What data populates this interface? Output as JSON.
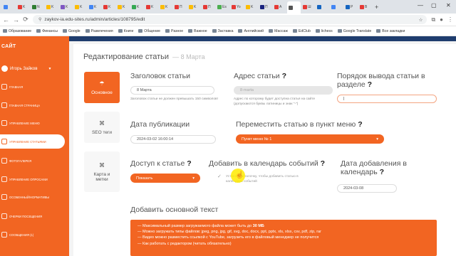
{
  "browser": {
    "url": "zaykov-ia.edu-sites.ru/admin/articles/108795/edit",
    "tabs": [
      {
        "label": "",
        "color": "#4285f4"
      },
      {
        "label": "K",
        "color": "#e53935"
      },
      {
        "label": "N",
        "color": "#2e7d32"
      },
      {
        "label": "K",
        "color": "#fbbc04"
      },
      {
        "label": "K",
        "color": "#7e57c2"
      },
      {
        "label": "K",
        "color": "#fbbc04"
      },
      {
        "label": "K",
        "color": "#4285f4"
      },
      {
        "label": "K",
        "color": "#e53935"
      },
      {
        "label": "K",
        "color": "#fbbc04"
      },
      {
        "label": "K",
        "color": "#34a853"
      },
      {
        "label": "K",
        "color": "#e53935"
      },
      {
        "label": "K",
        "color": "#fbbc04"
      },
      {
        "label": "П",
        "color": "#e53935"
      },
      {
        "label": "K",
        "color": "#fbbc04"
      },
      {
        "label": "П",
        "color": "#e53935"
      },
      {
        "label": "Es",
        "color": "#4caf50"
      },
      {
        "label": "Yo",
        "color": "#e53935"
      },
      {
        "label": "K",
        "color": "#fbbc04"
      },
      {
        "label": "П",
        "color": "#1a237e"
      },
      {
        "label": "А",
        "color": "#e53935"
      },
      {
        "label": "",
        "color": "#555555",
        "active": true
      },
      {
        "label": "Ш",
        "color": "#e53935"
      },
      {
        "label": "",
        "color": "#1565c0"
      },
      {
        "label": "",
        "color": "#4285f4"
      },
      {
        "label": "Р",
        "color": "#1565c0"
      },
      {
        "label": "В",
        "color": "#e53935"
      }
    ],
    "bookmarks": [
      "Образование",
      "Финансы",
      "Google",
      "Развлечения",
      "Книги",
      "Общение",
      "Разное",
      "Важное",
      "Заставка",
      "Английский",
      "Массаж",
      "EdClub",
      "lichess",
      "Google Translate",
      "Все закладки"
    ]
  },
  "sidebar": {
    "title": "САЙТ",
    "user": "Игорь Зайков",
    "items": [
      {
        "label": "Главная"
      },
      {
        "label": "Главная страница"
      },
      {
        "label": "Управление меню"
      },
      {
        "label": "Управление статьями",
        "active": true
      },
      {
        "label": "Фотогалерея"
      },
      {
        "label": "Управление опросами"
      },
      {
        "label": "Особенный/Нормативы"
      },
      {
        "label": "Очерки посещения"
      },
      {
        "label": "Сообщения (1)"
      }
    ]
  },
  "page": {
    "title": "Редактирование статьи",
    "date_suffix": "— 8 Марта"
  },
  "side_tabs": {
    "main": "Основное",
    "seo": "SEO теги",
    "map": "Карта и метки"
  },
  "fields": {
    "title_label": "Заголовок статьи",
    "title_value": "8 Марта",
    "title_hint": "Заголовок статьи не должен превышать 150 символов!",
    "address_label": "Адрес статьи",
    "address_value": "8-marta",
    "address_hint": "Адрес по которому будет доступна статья на сайте (допускаются буквы латиницы и знак \"-\")",
    "order_label": "Порядок вывода статьи в разделе",
    "order_value": "",
    "pubdate_label": "Дата публикации",
    "pubdate_value": "2024-03-02 16:00:14",
    "move_label": "Переместить статью в пункт меню",
    "move_value": "Пункт меню № 1",
    "access_label": "Доступ к статье",
    "access_value": "Показать",
    "calendar_label": "Добавить в календарь событий",
    "calendar_hint": "Установите галочку, чтобы добавить статью в календарь событий",
    "added_label": "Дата добавления в календарь",
    "added_value": "2024-03-08",
    "text_label": "Добавить основной текст"
  },
  "info": {
    "line1_pre": "— Максимальный размер загружаемого файла может быть до ",
    "line1_bold": "30 МБ",
    "line2": "— Можно загружать типы файлов: jpeg, png, jpg, gif, svg, doc, docx, ppt, pptx, xls, xlsx, csv, pdf, zip, rar",
    "line3": "— Видео можно разместить ссылкой с YouTube, загрузить его в файловый менеджер не получится",
    "line4": "— Как работать с редактором (читать обязательно)"
  },
  "colors": {
    "accent": "#f26522",
    "top_strip": "#1f3d6e",
    "cursor_highlight": "#ffeb00"
  }
}
